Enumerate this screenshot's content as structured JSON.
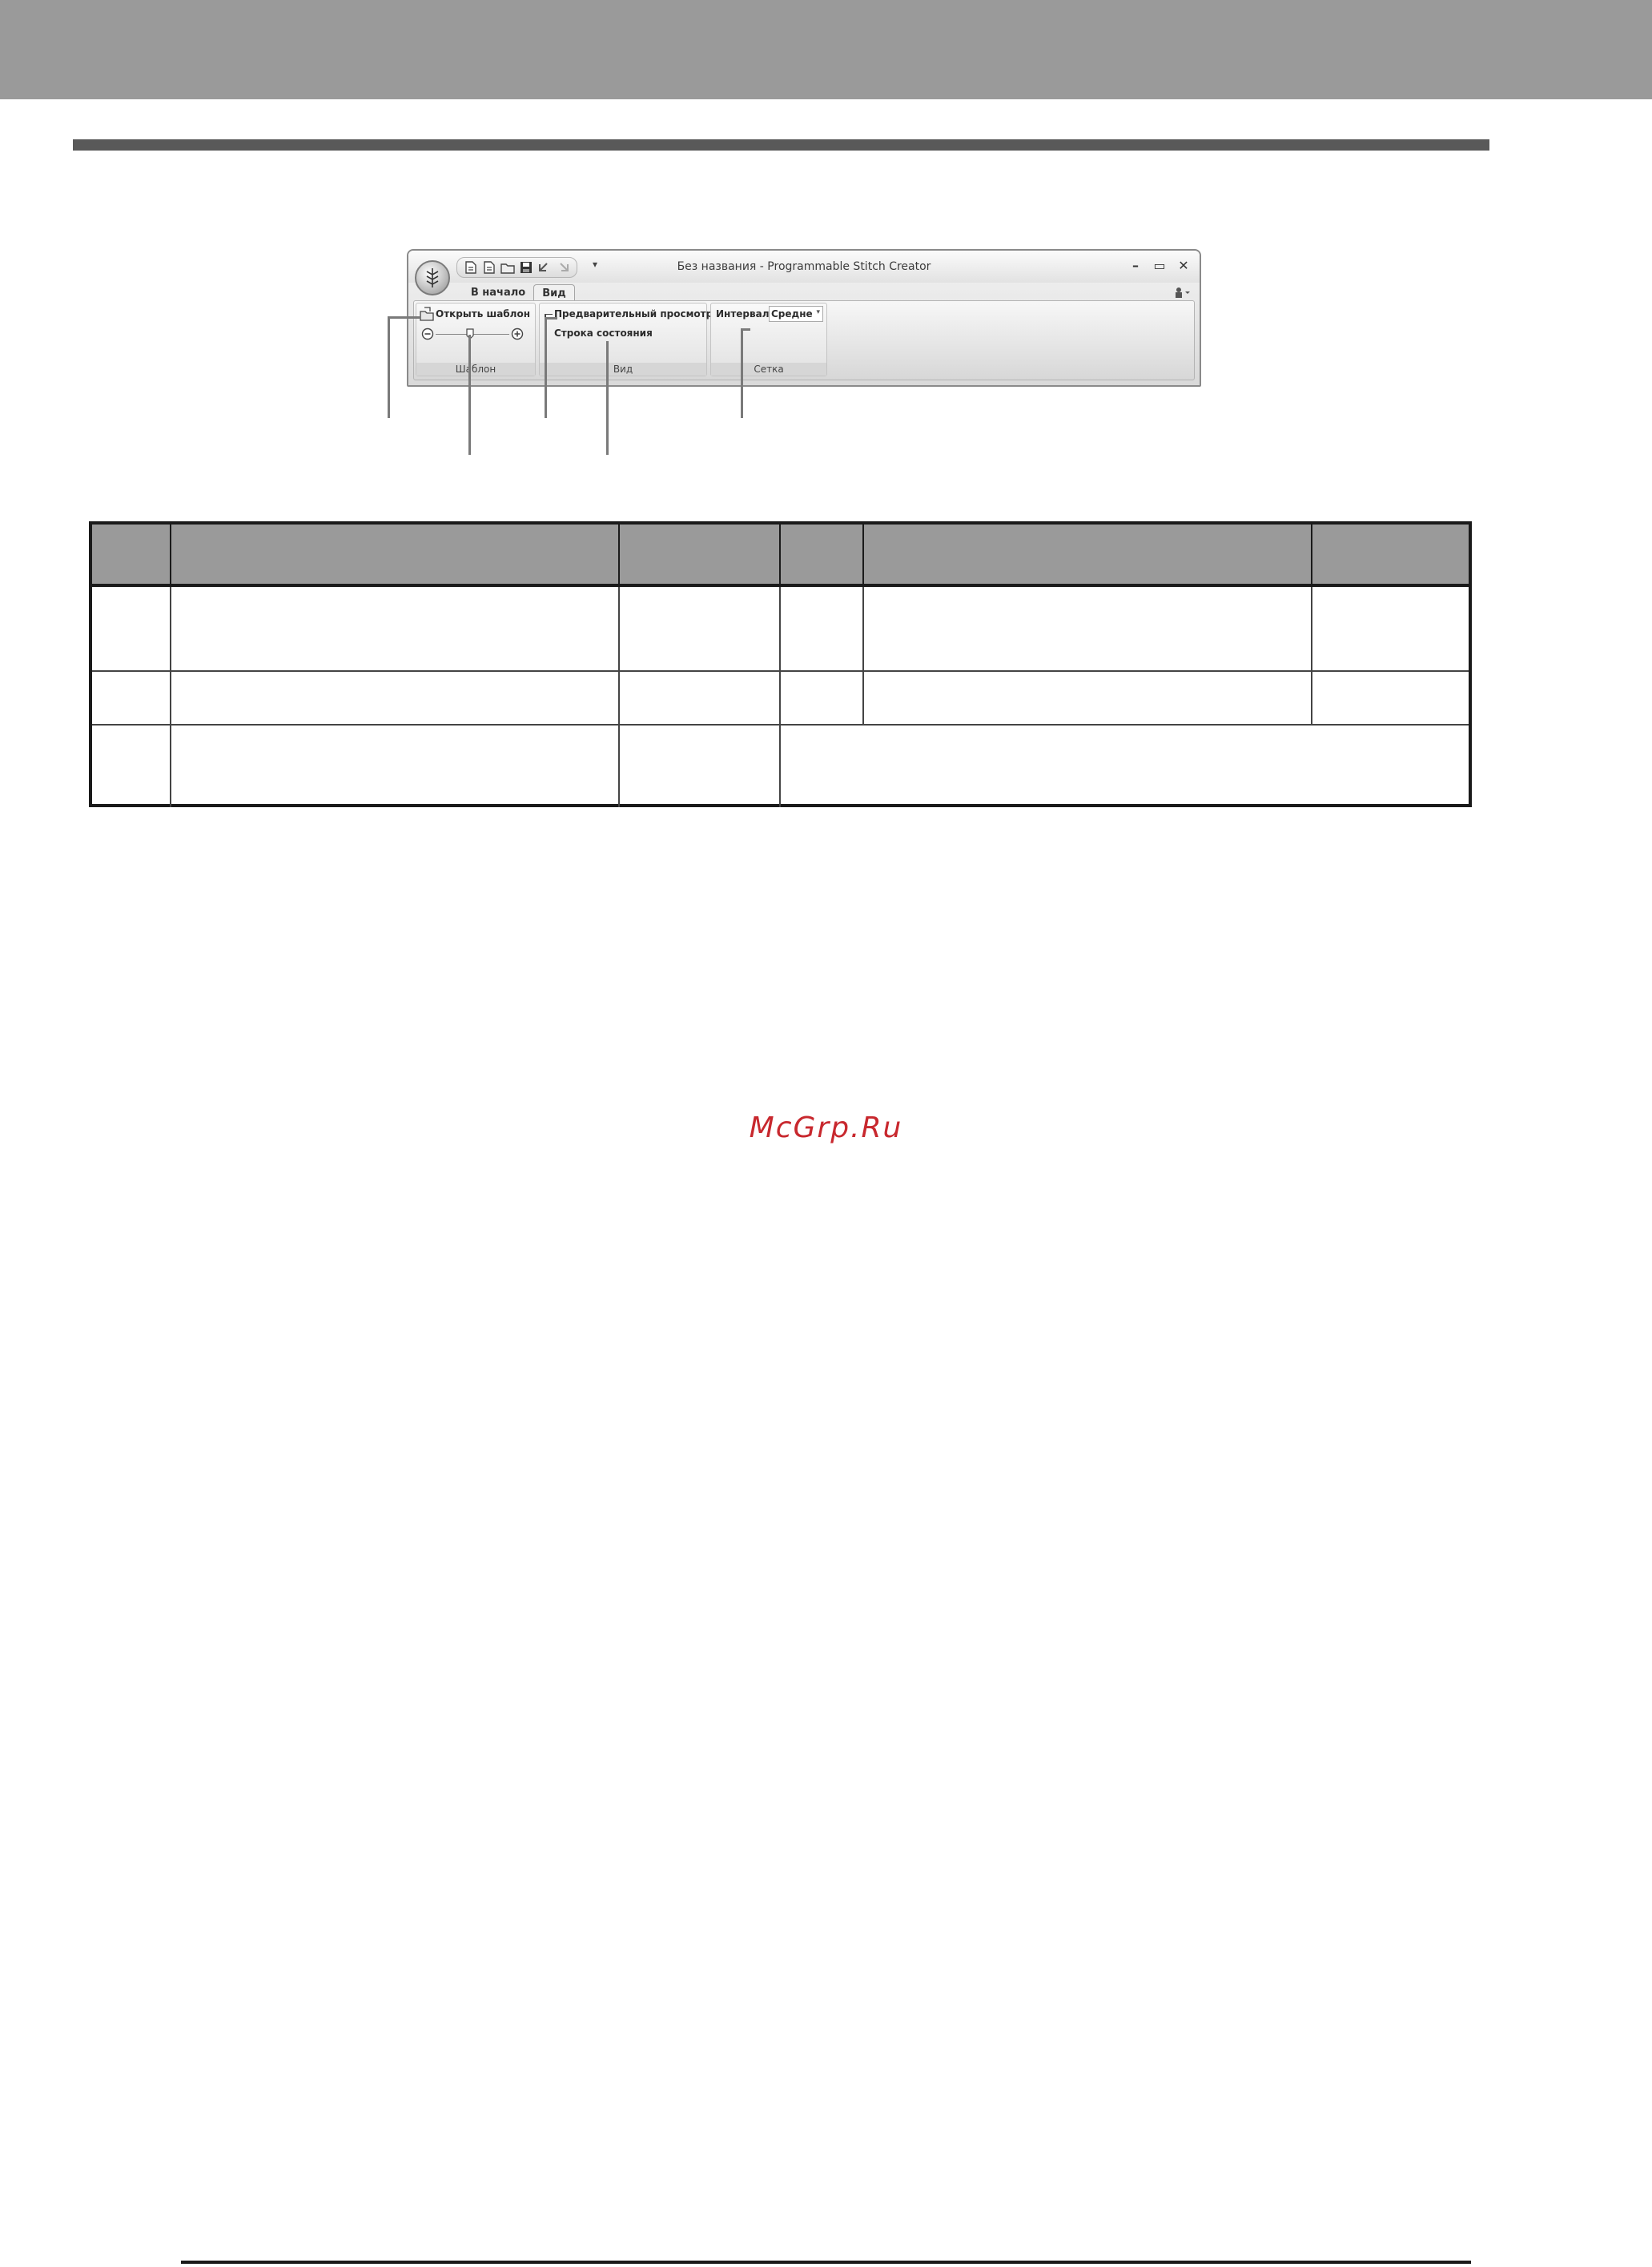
{
  "window": {
    "title": "Без названия - Programmable Stitch Creator"
  },
  "tabs": {
    "home": "В начало",
    "view": "Вид"
  },
  "groups": {
    "template": {
      "label": "Шаблон",
      "open_template": "Открыть шаблон"
    },
    "view": {
      "label": "Вид",
      "preview": "Предварительный просмотр",
      "status_bar": "Строка состояния"
    },
    "grid": {
      "label": "Сетка",
      "interval_label": "Интервал:",
      "interval_value": "Средне"
    }
  },
  "watermark": "McGrp.Ru",
  "icons": {
    "app": "app-orb-icon",
    "qat": [
      "new-file-icon",
      "new-file-icon",
      "open-folder-icon",
      "save-icon",
      "undo-icon",
      "redo-icon"
    ],
    "window": [
      "minimize-icon",
      "maximize-icon",
      "close-icon"
    ],
    "help": "help-icon"
  }
}
